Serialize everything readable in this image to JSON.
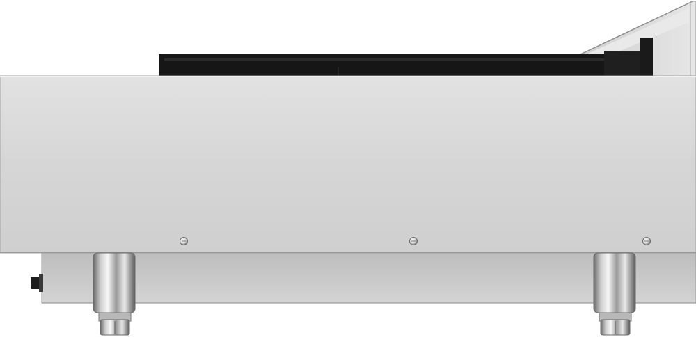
{
  "image": {
    "subject": "stainless-steel-commercial-griddle-side-view",
    "background_color": "#ffffff",
    "colors": {
      "steel_light": "#dcdcdc",
      "steel_mid": "#c9c9c9",
      "steel_dark": "#9e9e9e",
      "plate_black": "#151515",
      "chrome_highlight": "#f4f4f4",
      "chrome_shadow": "#5a5a5a"
    },
    "components": {
      "screw_count": 3,
      "leg_count": 2
    }
  }
}
